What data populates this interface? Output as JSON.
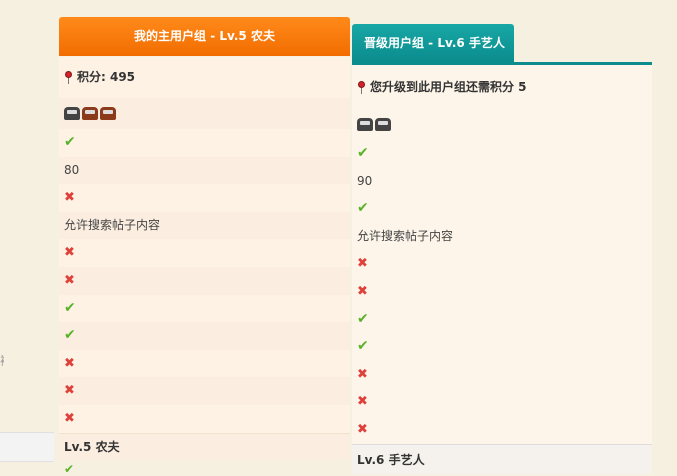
{
  "left_stub": {
    "char": "裱"
  },
  "current_group": {
    "header": "我的主用户组 - Lv.5 农夫",
    "points_label": "积分: 495",
    "icon_cars": [
      "grey",
      "brown",
      "brown"
    ],
    "rows": [
      {
        "type": "check"
      },
      {
        "type": "text",
        "value": "80"
      },
      {
        "type": "cross"
      },
      {
        "type": "text",
        "value": "允许搜索帖子内容"
      },
      {
        "type": "cross"
      },
      {
        "type": "cross"
      },
      {
        "type": "check"
      },
      {
        "type": "check"
      },
      {
        "type": "cross"
      },
      {
        "type": "cross"
      },
      {
        "type": "cross"
      }
    ],
    "level_name": "Lv.5 农夫"
  },
  "upgrade_group": {
    "header": "晋级用户组 - Lv.6 手艺人",
    "points_label": "您升级到此用户组还需积分 5",
    "icon_cars": [
      "grey",
      "grey"
    ],
    "rows": [
      {
        "type": "check"
      },
      {
        "type": "text",
        "value": "90"
      },
      {
        "type": "check"
      },
      {
        "type": "text",
        "value": "允许搜索帖子内容"
      },
      {
        "type": "cross"
      },
      {
        "type": "cross"
      },
      {
        "type": "check"
      },
      {
        "type": "check"
      },
      {
        "type": "cross"
      },
      {
        "type": "cross"
      },
      {
        "type": "cross"
      }
    ],
    "level_name": "Lv.6 手艺人"
  },
  "colors": {
    "accent_orange": "#f26d00",
    "accent_teal": "#0b8c8d",
    "check": "#5ab22a",
    "cross": "#e0403a"
  },
  "glyphs": {
    "check": "✔",
    "cross": "✖"
  }
}
